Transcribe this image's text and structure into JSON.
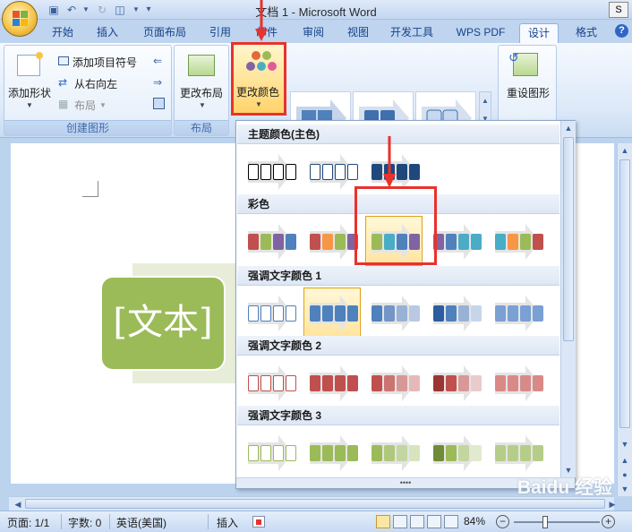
{
  "window": {
    "title": "文档 1 - Microsoft Word",
    "right_clip": "S"
  },
  "tabs": [
    {
      "label": "开始"
    },
    {
      "label": "插入"
    },
    {
      "label": "页面布局"
    },
    {
      "label": "引用"
    },
    {
      "label": "邮件"
    },
    {
      "label": "审阅"
    },
    {
      "label": "视图"
    },
    {
      "label": "开发工具"
    },
    {
      "label": "WPS PDF"
    },
    {
      "label": "设计",
      "active": true
    },
    {
      "label": "格式"
    }
  ],
  "ribbon": {
    "create_group": {
      "add_shape": "添加形状",
      "add_bullet": "添加项目符号",
      "right_to_left": "从右向左",
      "layout": "布局",
      "label": "创建图形"
    },
    "layout_group": {
      "change_layout": "更改布局",
      "label": "布局"
    },
    "change_color": "更改颜色",
    "reset": "重设图形"
  },
  "gallery": {
    "sections": [
      {
        "title": "主题颜色(主色)",
        "styles": [
          {
            "colors": [
              "#ffffff",
              "#ffffff",
              "#ffffff",
              "#ffffff"
            ],
            "stroke": "#000000"
          },
          {
            "colors": [
              "#ffffff",
              "#ffffff",
              "#ffffff",
              "#ffffff"
            ],
            "stroke": "#1f497d"
          },
          {
            "colors": [
              "#1f497d",
              "#1f497d",
              "#1f497d",
              "#1f497d"
            ],
            "stroke": "#1f497d"
          }
        ]
      },
      {
        "title": "彩色",
        "styles": [
          {
            "colors": [
              "#c0504d",
              "#9bbb59",
              "#8064a2",
              "#4f81bd"
            ]
          },
          {
            "colors": [
              "#c0504d",
              "#f79646",
              "#9bbb59",
              "#8064a2"
            ]
          },
          {
            "colors": [
              "#9bbb59",
              "#4bacc6",
              "#4f81bd",
              "#8064a2"
            ],
            "selected": true
          },
          {
            "colors": [
              "#8064a2",
              "#4f81bd",
              "#4bacc6",
              "#4bacc6"
            ]
          },
          {
            "colors": [
              "#4bacc6",
              "#f79646",
              "#9bbb59",
              "#c0504d"
            ]
          }
        ]
      },
      {
        "title": "强调文字颜色 1",
        "styles": [
          {
            "colors": [
              "#ffffff",
              "#ffffff",
              "#ffffff",
              "#ffffff"
            ],
            "stroke": "#4f81bd"
          },
          {
            "colors": [
              "#4f81bd",
              "#4f81bd",
              "#4f81bd",
              "#4f81bd"
            ],
            "selected": true
          },
          {
            "colors": [
              "#4f81bd",
              "#7396c8",
              "#98b1d6",
              "#b9c9e3"
            ]
          },
          {
            "colors": [
              "#2c5d9e",
              "#4f81bd",
              "#98b1d6",
              "#c6d5ea"
            ]
          },
          {
            "colors": [
              "#7aa0d4",
              "#7aa0d4",
              "#7aa0d4",
              "#7aa0d4"
            ]
          }
        ]
      },
      {
        "title": "强调文字颜色 2",
        "styles": [
          {
            "colors": [
              "#ffffff",
              "#ffffff",
              "#ffffff",
              "#ffffff"
            ],
            "stroke": "#c0504d"
          },
          {
            "colors": [
              "#c0504d",
              "#c0504d",
              "#c0504d",
              "#c0504d"
            ]
          },
          {
            "colors": [
              "#c0504d",
              "#cd7471",
              "#d99795",
              "#e6b9b8"
            ]
          },
          {
            "colors": [
              "#9a3532",
              "#c0504d",
              "#d99795",
              "#ebcbca"
            ]
          },
          {
            "colors": [
              "#d98a88",
              "#d98a88",
              "#d98a88",
              "#d98a88"
            ]
          }
        ]
      },
      {
        "title": "强调文字颜色 3",
        "styles": [
          {
            "colors": [
              "#ffffff",
              "#ffffff",
              "#ffffff",
              "#ffffff"
            ],
            "stroke": "#9bbb59"
          },
          {
            "colors": [
              "#9bbb59",
              "#9bbb59",
              "#9bbb59",
              "#9bbb59"
            ]
          },
          {
            "colors": [
              "#9bbb59",
              "#afc87c",
              "#c3d69f",
              "#d7e4bd"
            ]
          },
          {
            "colors": [
              "#6f8b35",
              "#9bbb59",
              "#c3d69f",
              "#e1eacc"
            ]
          },
          {
            "colors": [
              "#b6cd8a",
              "#b6cd8a",
              "#b6cd8a",
              "#b6cd8a"
            ]
          }
        ]
      }
    ]
  },
  "document": {
    "smartart_text": "[文本]"
  },
  "status": {
    "page": "页面: 1/1",
    "words": "字数: 0",
    "language": "英语(美国)",
    "insert": "插入",
    "zoom": "84%"
  },
  "watermark": "Baidu 经验"
}
